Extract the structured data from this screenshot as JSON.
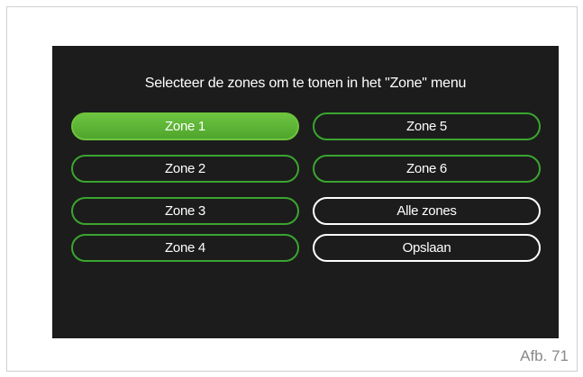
{
  "screen": {
    "prompt": "Selecteer de zones om te tonen in het \"Zone\" menu",
    "buttons": {
      "zone1": "Zone 1",
      "zone2": "Zone 2",
      "zone3": "Zone 3",
      "zone4": "Zone 4",
      "zone5": "Zone 5",
      "zone6": "Zone 6",
      "all_zones": "Alle zones",
      "save": "Opslaan"
    },
    "selected": "Zone 1"
  },
  "caption": "Afb. 71",
  "colors": {
    "screen_bg": "#1c1c1c",
    "accent_green": "#3aa52f",
    "selected_fill": "#5cb536",
    "text": "#ffffff"
  }
}
